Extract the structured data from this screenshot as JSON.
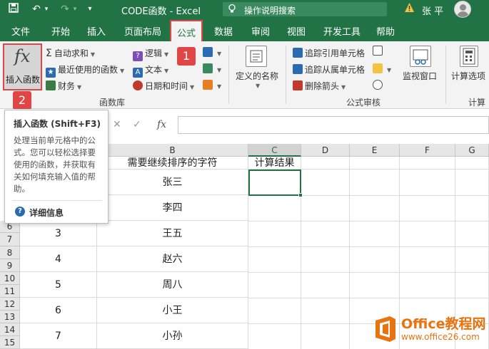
{
  "window": {
    "title": "CODE函数  -  Excel",
    "search_placeholder": "操作说明搜索",
    "user_name": "张 平"
  },
  "tabs": [
    "文件",
    "开始",
    "插入",
    "页面布局",
    "公式",
    "数据",
    "审阅",
    "视图",
    "开发工具",
    "帮助"
  ],
  "active_tab": "公式",
  "ribbon": {
    "insert_function": "插入函数",
    "autosum": "自动求和",
    "recent": "最近使用的函数",
    "financial": "财务",
    "logical": "逻辑",
    "text": "文本",
    "datetime": "日期和时间",
    "function_library": "函数库",
    "defined_names": "定义的名称",
    "trace_precedents": "追踪引用单元格",
    "trace_dependents": "追踪从属单元格",
    "remove_arrows": "删除箭头",
    "formula_auditing": "公式审核",
    "watch_window": "监视窗口",
    "calc_options": "计算选项",
    "calculation": "计算"
  },
  "annotations": {
    "badge1": "1",
    "badge2": "2"
  },
  "tooltip": {
    "title": "插入函数 (Shift+F3)",
    "body": "处理当前单元格中的公式。您可以轻松选择要使用的函数，并获取有关如何填充输入值的帮助。",
    "more": "详细信息"
  },
  "formula_bar": {
    "cancel": "✕",
    "enter": "✓",
    "fx": "fx"
  },
  "grid": {
    "columns": [
      "B",
      "C",
      "D",
      "E",
      "F",
      "G"
    ],
    "row_numbers": [
      "6",
      "7",
      "8",
      "9",
      "10",
      "11",
      "12",
      "13",
      "14",
      "15"
    ],
    "header_b": "需要继续排序的字符",
    "header_c": "计算结果",
    "rows": [
      {
        "a": "",
        "b": "张三"
      },
      {
        "a": "",
        "b": "李四"
      },
      {
        "a": "3",
        "b": "王五"
      },
      {
        "a": "4",
        "b": "赵六"
      },
      {
        "a": "5",
        "b": "周八"
      },
      {
        "a": "6",
        "b": "小王"
      },
      {
        "a": "7",
        "b": "小孙"
      }
    ]
  },
  "watermark": {
    "brand": "Office教程网",
    "url": "www.office26.com"
  },
  "colors": {
    "excel_green": "#217346",
    "highlight_red": "#e04646",
    "watermark_orange": "#e8730f"
  }
}
